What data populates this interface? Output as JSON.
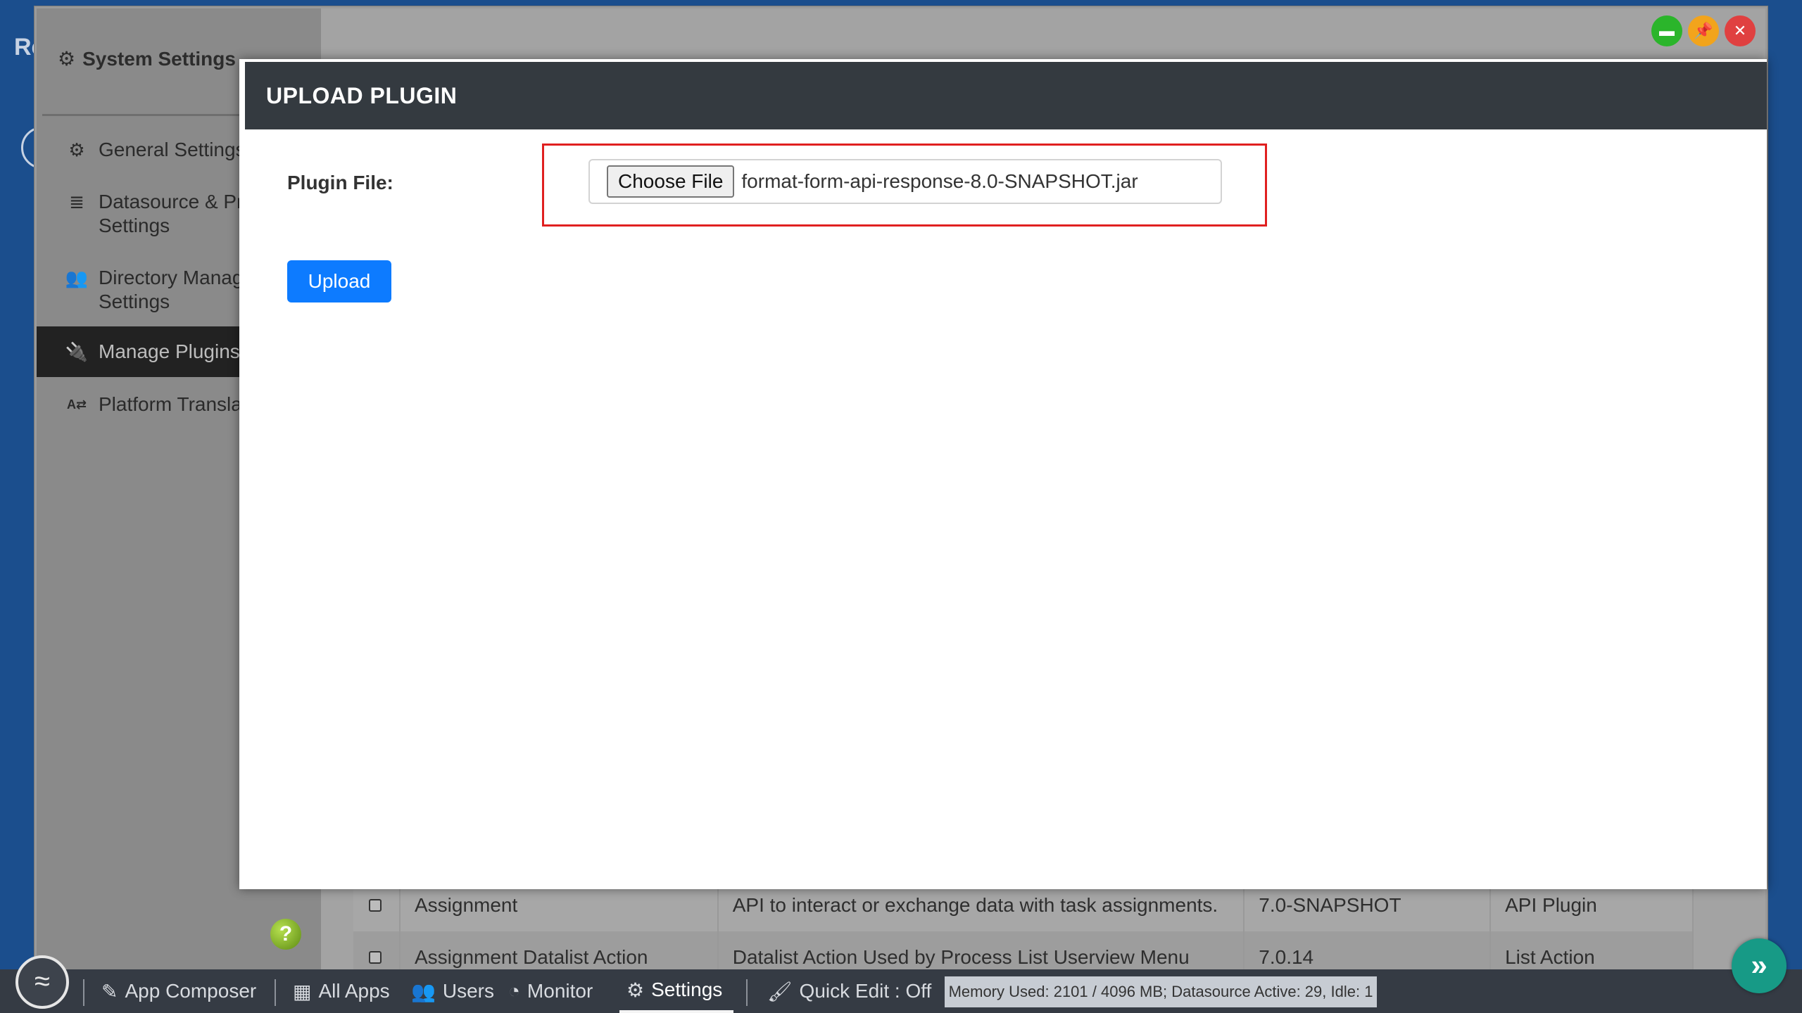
{
  "background": {
    "app_title": "Re",
    "sidebar": {
      "title": "System Settings",
      "title_icon": "gears-icon",
      "items": [
        {
          "icon": "gear-icon",
          "glyph": "⚙",
          "line1": "General Settings",
          "line2": ""
        },
        {
          "icon": "database-icon",
          "glyph": "≣",
          "line1": "Datasource & Pr",
          "line2": "Settings"
        },
        {
          "icon": "users-icon",
          "glyph": "👥",
          "line1": "Directory Manag",
          "line2": "Settings"
        },
        {
          "icon": "plug-icon",
          "glyph": "🔌",
          "line1": "Manage Plugins",
          "line2": ""
        },
        {
          "icon": "translate-icon",
          "glyph": "A⇄",
          "line1": "Platform Translat",
          "line2": ""
        }
      ],
      "active_index": 3,
      "help_label": "?"
    },
    "table": {
      "rows": [
        {
          "name": "Assignment",
          "description": "API to interact or exchange data with task assignments.",
          "version": "7.0-SNAPSHOT",
          "type": "API Plugin"
        },
        {
          "name": "Assignment Datalist Action",
          "description": "Datalist Action Used by Process List Userview Menu",
          "version": "7.0.14",
          "type": "List Action"
        }
      ]
    },
    "window_buttons": {
      "maximize": "▬",
      "pin": "📌",
      "close": "✕"
    }
  },
  "modal": {
    "title": "UPLOAD PLUGIN",
    "plugin_file_label": "Plugin File:",
    "choose_file_label": "Choose File",
    "file_name": "format-form-api-response-8.0-SNAPSHOT.jar",
    "upload_label": "Upload",
    "highlight_color": "#e02020",
    "upload_color": "#0d7bff"
  },
  "taskbar": {
    "items": [
      {
        "icon": "edit-icon",
        "glyph": "✎",
        "label": "App Composer"
      },
      {
        "icon": "grid-icon",
        "glyph": "▦",
        "label": "All Apps"
      },
      {
        "icon": "users-icon",
        "glyph": "👥",
        "label": "Users"
      },
      {
        "icon": "dashboard-icon",
        "glyph": "◔",
        "label": "Monitor"
      },
      {
        "icon": "gears-icon",
        "glyph": "⚙",
        "label": "Settings"
      },
      {
        "icon": "brush-icon",
        "glyph": "🖌",
        "label": "Quick Edit : Off"
      }
    ],
    "active": "Settings",
    "memory_status": "Memory Used: 2101 / 4096 MB; Datasource Active: 29, Idle: 1",
    "next_glyph": "»"
  }
}
